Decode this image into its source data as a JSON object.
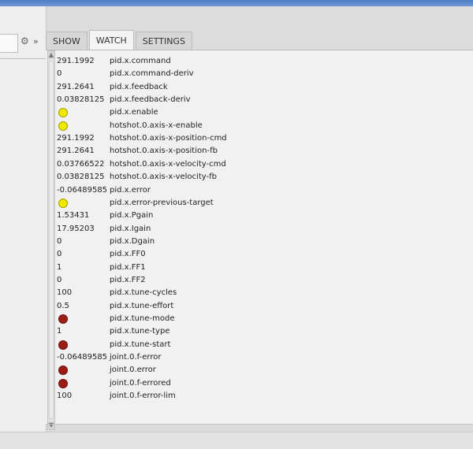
{
  "tabs": [
    "SHOW",
    "WATCH",
    "SETTINGS"
  ],
  "active_tab": "WATCH",
  "watch_rows": [
    {
      "value": "291.1992",
      "signal": "pid.x.command",
      "led": ""
    },
    {
      "value": "0",
      "signal": "pid.x.command-deriv",
      "led": ""
    },
    {
      "value": "291.2641",
      "signal": "pid.x.feedback",
      "led": ""
    },
    {
      "value": "0.03828125",
      "signal": "pid.x.feedback-deriv",
      "led": ""
    },
    {
      "value": "",
      "signal": "pid.x.enable",
      "led": "yellow"
    },
    {
      "value": "",
      "signal": "hotshot.0.axis-x-enable",
      "led": "yellow"
    },
    {
      "value": "291.1992",
      "signal": "hotshot.0.axis-x-position-cmd",
      "led": ""
    },
    {
      "value": "291.2641",
      "signal": "hotshot.0.axis-x-position-fb",
      "led": ""
    },
    {
      "value": "0.03766522",
      "signal": "hotshot.0.axis-x-velocity-cmd",
      "led": ""
    },
    {
      "value": "0.03828125",
      "signal": "hotshot.0.axis-x-velocity-fb",
      "led": ""
    },
    {
      "value": "-0.06489585",
      "signal": "pid.x.error",
      "led": ""
    },
    {
      "value": "",
      "signal": "pid.x.error-previous-target",
      "led": "yellow"
    },
    {
      "value": "1.53431",
      "signal": "pid.x.Pgain",
      "led": ""
    },
    {
      "value": "17.95203",
      "signal": "pid.x.Igain",
      "led": ""
    },
    {
      "value": "0",
      "signal": "pid.x.Dgain",
      "led": ""
    },
    {
      "value": "0",
      "signal": "pid.x.FF0",
      "led": ""
    },
    {
      "value": "1",
      "signal": "pid.x.FF1",
      "led": ""
    },
    {
      "value": "0",
      "signal": "pid.x.FF2",
      "led": ""
    },
    {
      "value": "100",
      "signal": "pid.x.tune-cycles",
      "led": ""
    },
    {
      "value": "0.5",
      "signal": "pid.x.tune-effort",
      "led": ""
    },
    {
      "value": "",
      "signal": "pid.x.tune-mode",
      "led": "red"
    },
    {
      "value": "1",
      "signal": "pid.x.tune-type",
      "led": ""
    },
    {
      "value": "",
      "signal": "pid.x.tune-start",
      "led": "red"
    },
    {
      "value": "-0.06489585",
      "signal": "joint.0.f-error",
      "led": ""
    },
    {
      "value": "",
      "signal": "joint.0.error",
      "led": "red"
    },
    {
      "value": "",
      "signal": "joint.0.f-errored",
      "led": "red"
    },
    {
      "value": "100",
      "signal": "joint.0.f-error-lim",
      "led": ""
    }
  ]
}
